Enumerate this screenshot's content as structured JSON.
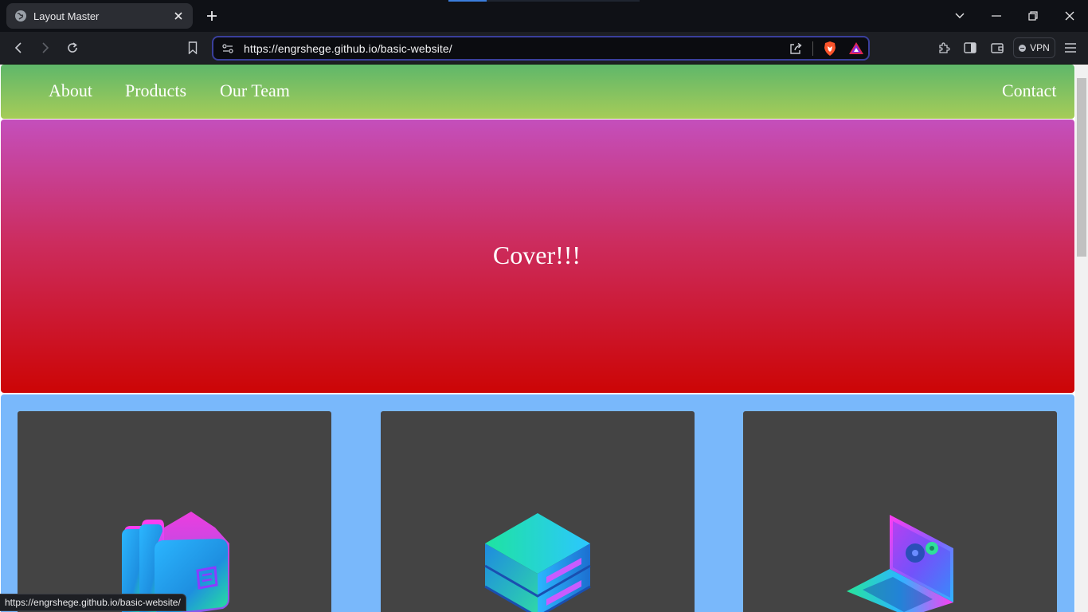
{
  "browser": {
    "tab": {
      "title": "Layout Master"
    },
    "address_bar": {
      "url": "https://engrshege.github.io/basic-website/"
    },
    "vpn_label": "VPN",
    "status_url": "https://engrshege.github.io/basic-website/"
  },
  "page": {
    "nav": {
      "left_links": [
        "About",
        "Products",
        "Our Team"
      ],
      "right_link": "Contact"
    },
    "cover": {
      "text": "Cover!!!"
    },
    "cards": [
      {
        "icon": "folders-icon"
      },
      {
        "icon": "server-stack-icon"
      },
      {
        "icon": "laptop-settings-icon"
      }
    ]
  },
  "colors": {
    "nav_gradient": [
      "#5fb76a",
      "#a6cc58"
    ],
    "cover_gradient": [
      "#c44fbc",
      "#cc0505"
    ],
    "cards_background": "#79b8fb",
    "card_background": "#444444"
  }
}
